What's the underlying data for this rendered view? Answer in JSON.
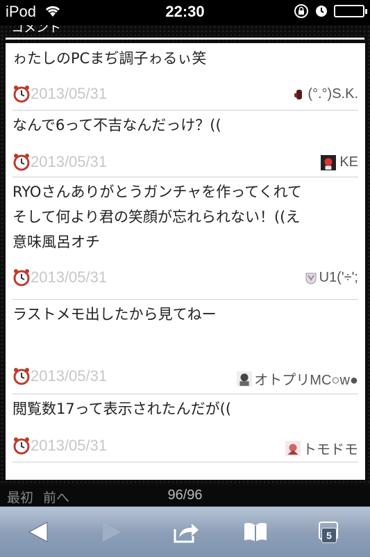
{
  "status_bar": {
    "carrier": "iPod",
    "time": "22:30",
    "battery_level": 0.0
  },
  "header": {
    "title_fragment": "コメント"
  },
  "comments": [
    {
      "text": "ゎたしのPCまぢ調子ゎるぃ笑",
      "date": "2013/05/31",
      "author": "(°.°)S.K.",
      "avatar_icon": "hand-avatar-icon"
    },
    {
      "text": "なんで6って不吉なんだっけ？((",
      "date": "2013/05/31",
      "author": "KE",
      "avatar_icon": "character-avatar-icon"
    },
    {
      "text": "RYOさんありがとうガンチャを作ってくれて\nそして何より君の笑顔が忘れられない！((え\n意味風呂オチ",
      "date": "2013/05/31",
      "author": "U1('÷';",
      "avatar_icon": "shield-avatar-icon"
    },
    {
      "text": "ラストメモ出したから見てねー",
      "date": "2013/05/31",
      "author": "オトプリMC○w●",
      "avatar_icon": "character-avatar-icon"
    },
    {
      "text": "閲覧数17って表示されたんだが((",
      "date": "2013/05/31",
      "author": "トモドモ",
      "avatar_icon": "character-avatar-icon"
    }
  ],
  "pager": {
    "first": "最初",
    "prev": "前へ",
    "page": "96/96"
  },
  "toolbar": {
    "tab_count": "5"
  }
}
